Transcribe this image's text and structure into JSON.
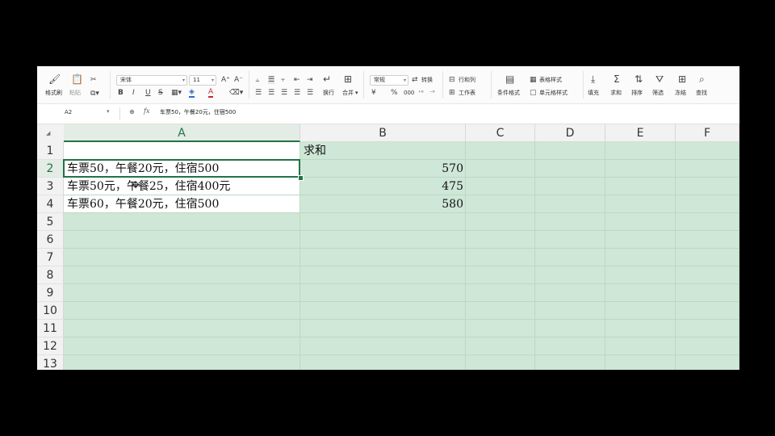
{
  "ribbon": {
    "clipboard": {
      "format_painter": "格式刷",
      "paste": "粘贴",
      "cut_icon": "scissors-icon",
      "copy_icon": "copy-icon"
    },
    "font": {
      "name": "宋体",
      "size": "11",
      "grow": "A⁺",
      "shrink": "A⁻",
      "bold": "B",
      "italic": "I",
      "underline": "U",
      "strike": "S",
      "font_color": "A"
    },
    "align": {
      "wrap": "换行",
      "merge": "合并"
    },
    "number": {
      "format": "常规",
      "convert": "转换",
      "percent": "%",
      "thousands": "000",
      "currency": "¥"
    },
    "rows_cols": "行和列",
    "worksheet": "工作表",
    "cond_format": "条件格式",
    "table_style": "表格样式",
    "cell_style": "单元格样式",
    "fill": "填充",
    "sum": "求和",
    "sort": "排序",
    "filter": "筛选",
    "freeze": "冻结",
    "find": "查找"
  },
  "formula_bar": {
    "name_box": "A2",
    "fx": "fx",
    "content": "车票50，午餐20元，住宿500"
  },
  "grid": {
    "columns": [
      "A",
      "B",
      "C",
      "D",
      "E",
      "F"
    ],
    "active_column": "A",
    "rows": [
      "1",
      "2",
      "3",
      "4",
      "5",
      "6",
      "7",
      "8",
      "9",
      "10",
      "11",
      "12",
      "13"
    ],
    "active_row": "2",
    "cells": {
      "B1": "求和",
      "A2": "车票50，午餐20元，住宿500",
      "B2": "570",
      "A3": "车票50元，午餐25，住宿400元",
      "B3": "475",
      "A4": "车票60，午餐20元，住宿500",
      "B4": "580"
    }
  },
  "colors": {
    "accent": "#217346",
    "selection_fill": "#cfe7d6",
    "background": "#000000"
  }
}
